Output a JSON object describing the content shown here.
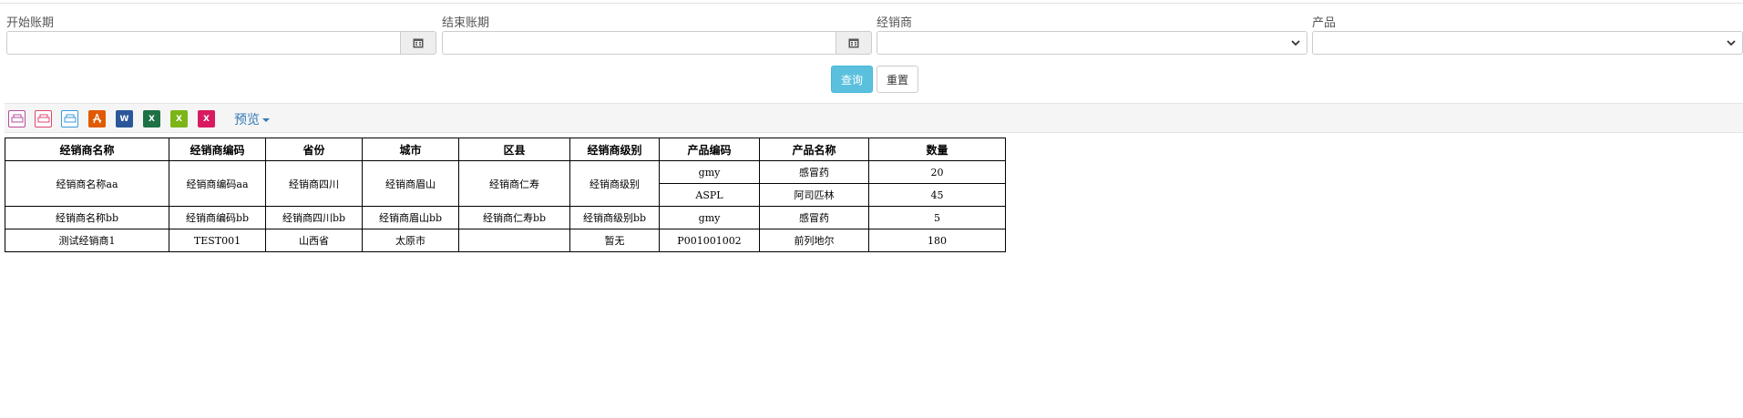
{
  "filters": {
    "start_period_label": "开始账期",
    "end_period_label": "结束账期",
    "dealer_label": "经销商",
    "product_label": "产品",
    "start_period_value": "",
    "end_period_value": "",
    "dealer_selected": "",
    "product_selected": ""
  },
  "buttons": {
    "query": "查询",
    "reset": "重置"
  },
  "toolbar": {
    "icons": [
      "print-icon",
      "print-pdf-icon",
      "print-preview-icon",
      "export-pdf-icon",
      "export-word-icon",
      "export-excel-icon",
      "export-excel-alt-icon",
      "export-excel-data-icon"
    ],
    "preview_label": "预览"
  },
  "table": {
    "headers": [
      "经销商名称",
      "经销商编码",
      "省份",
      "城市",
      "区县",
      "经销商级别",
      "产品编码",
      "产品名称",
      "数量"
    ],
    "rows": [
      {
        "dealer_name": "经销商名称aa",
        "dealer_code": "经销商编码aa",
        "province": "经销商四川",
        "city": "经销商眉山",
        "district": "经销商仁寿",
        "level": "经销商级别",
        "products": [
          {
            "code": "gmy",
            "name": "感冒药",
            "qty": "20"
          },
          {
            "code": "ASPL",
            "name": "阿司匹林",
            "qty": "45"
          }
        ]
      },
      {
        "dealer_name": "经销商名称bb",
        "dealer_code": "经销商编码bb",
        "province": "经销商四川bb",
        "city": "经销商眉山bb",
        "district": "经销商仁寿bb",
        "level": "经销商级别bb",
        "products": [
          {
            "code": "gmy",
            "name": "感冒药",
            "qty": "5"
          }
        ]
      },
      {
        "dealer_name": "测试经销商1",
        "dealer_code": "TEST001",
        "province": "山西省",
        "city": "太原市",
        "district": "",
        "level": "暂无",
        "products": [
          {
            "code": "P001001002",
            "name": "前列地尔",
            "qty": "180"
          }
        ]
      }
    ]
  }
}
